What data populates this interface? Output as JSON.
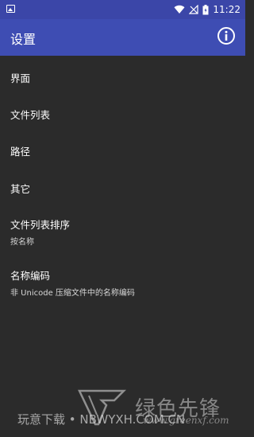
{
  "status_bar": {
    "time": "11:22",
    "icons": [
      "photo-icon",
      "wifi-icon",
      "no-signal-icon",
      "battery-icon"
    ]
  },
  "app_bar": {
    "title": "设置",
    "action_icon": "info-icon",
    "background": "#3e4db3"
  },
  "settings": {
    "items": [
      {
        "title": "界面",
        "summary": ""
      },
      {
        "title": "文件列表",
        "summary": ""
      },
      {
        "title": "路径",
        "summary": ""
      },
      {
        "title": "其它",
        "summary": ""
      },
      {
        "title": "文件列表排序",
        "summary": "按名称"
      },
      {
        "title": "名称编码",
        "summary": "非 Unicode 压缩文件中的名称编码"
      }
    ]
  },
  "watermark": {
    "text": "玩意下载 • NBWYXH.COM.CN",
    "brand": "绿色先锋",
    "url": "www.greenxf.com"
  },
  "colors": {
    "status_bar": "#3b46a8",
    "background": "#2b2b2b",
    "text": "#ffffff",
    "summary": "#d6d6d6"
  }
}
